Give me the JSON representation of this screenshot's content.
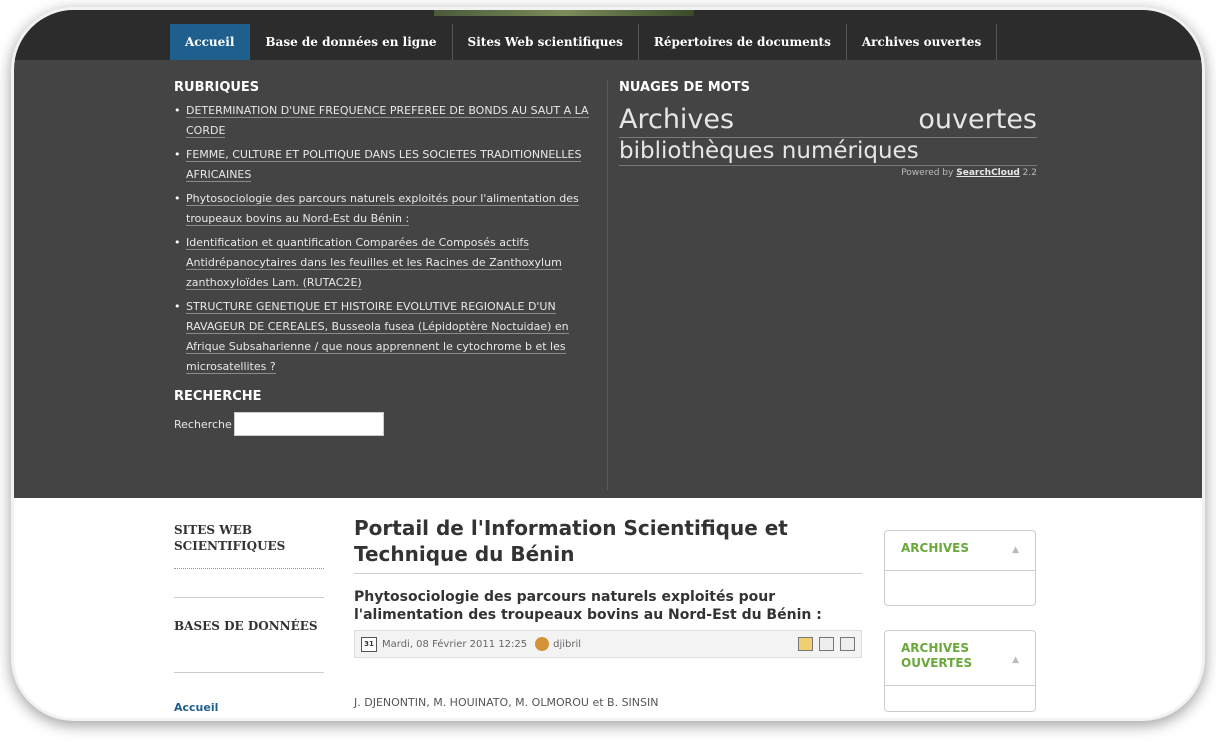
{
  "nav": {
    "items": [
      {
        "label": "Accueil",
        "active": true
      },
      {
        "label": "Base de données en ligne",
        "active": false
      },
      {
        "label": "Sites Web scientifiques",
        "active": false
      },
      {
        "label": "Répertoires de documents",
        "active": false
      },
      {
        "label": "Archives ouvertes",
        "active": false
      }
    ]
  },
  "rubriques": {
    "title": "RUBRIQUES",
    "items": [
      "DETERMINATION D'UNE FREQUENCE PREFEREE DE BONDS AU SAUT A LA CORDE",
      "FEMME, CULTURE ET POLITIQUE DANS LES SOCIETES TRADITIONNELLES AFRICAINES",
      "Phytosociologie des parcours naturels exploités pour l'alimentation des troupeaux bovins au Nord-Est du Bénin :",
      "Identification et quantification Comparées de Composés actifs Antidrépanocytaires dans les feuilles et les Racines de Zanthoxylum zanthoxyloïdes Lam. (RUTAC2E)",
      "STRUCTURE GENETIQUE ET HISTOIRE EVOLUTIVE REGIONALE D'UN RAVAGEUR DE CEREALES, Busseola fusea (Lépidoptère Noctuidae) en Afrique Subsaharienne / que nous apprennent le cytochrome b et les microsatellites ?"
    ]
  },
  "recherche": {
    "title": "RECHERCHE",
    "label": "Recherche",
    "value": ""
  },
  "cloud": {
    "title": "NUAGES DE MOTS",
    "words_line1": [
      "Archives",
      "ouvertes"
    ],
    "words_line2": "bibliothèques numériques",
    "powered_prefix": "Powered by",
    "powered_link": "SearchCloud",
    "powered_version": "2.2"
  },
  "sidebar": {
    "section1": "SITES WEB SCIENTIFIQUES",
    "section2": "BASES DE DONNÉES",
    "link": "Accueil"
  },
  "main": {
    "title": "Portail de l'Information Scientifique et Technique du Bénin",
    "article_title": "Phytosociologie des parcours naturels exploités pour l'alimentation des troupeaux bovins au Nord-Est du Bénin :",
    "date": "Mardi, 08 Février 2011 12:25",
    "calendar_day": "31",
    "author": "djibril",
    "authors_line": "J. DJENONTIN, M. HOUINATO, M. OLMOROU et B. SINSIN"
  },
  "right": {
    "box1": "ARCHIVES",
    "box2": "ARCHIVES OUVERTES"
  },
  "icons": [
    "calendar-icon",
    "user-icon",
    "edit-icon",
    "print-icon",
    "email-icon",
    "collapse-caret-icon"
  ],
  "colors": {
    "nav_active": "#1f5f8e",
    "header_bg": "#444444",
    "box_title": "#6aa83a",
    "link_blue": "#1f5f8e"
  }
}
